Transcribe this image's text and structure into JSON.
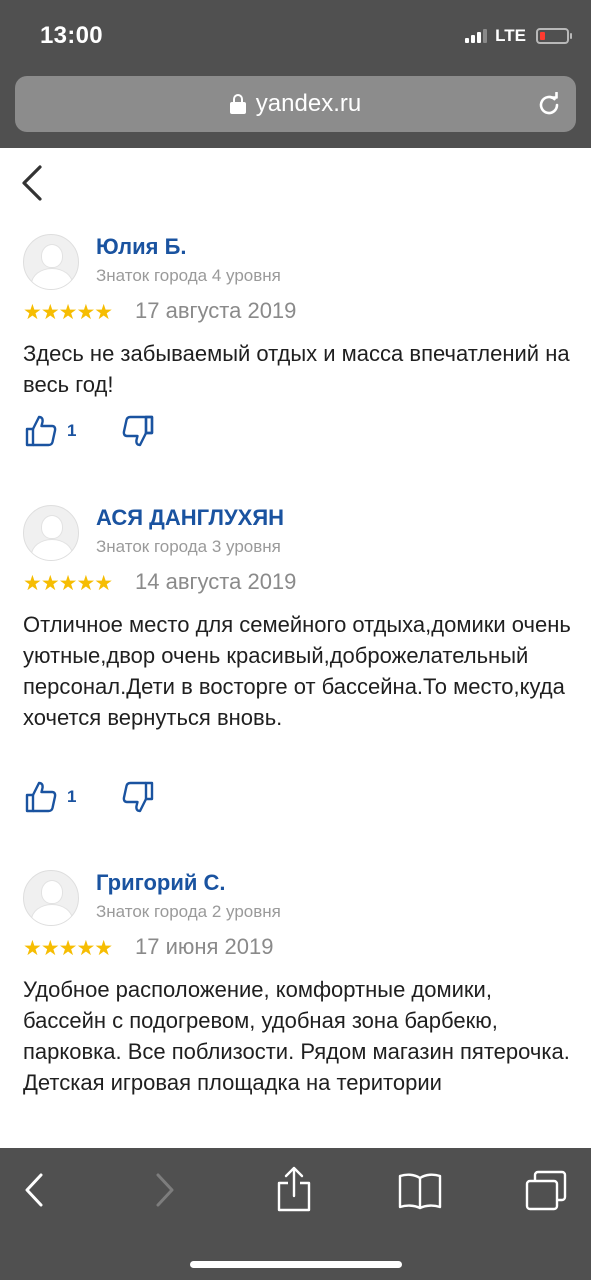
{
  "status_bar": {
    "time": "13:00",
    "network": "LTE"
  },
  "browser": {
    "url": "yandex.ru"
  },
  "reviews": [
    {
      "name": "Юлия Б.",
      "level": "Знаток города 4 уровня",
      "rating": 5,
      "stars": "★★★★★",
      "date": "17 августа 2019",
      "text": "Здесь не забываемый отдых и масса впечатлений на весь год!",
      "likes": "1"
    },
    {
      "name": "АСЯ ДАНГЛУХЯН",
      "level": "Знаток города 3 уровня",
      "rating": 5,
      "stars": "★★★★★",
      "date": "14 августа 2019",
      "text": "Отличное место для семейного отдыха,домики очень уютные,двор очень красивый,доброжелательный персонал.Дети в восторге от бассейна.То место,куда хочется вернуться вновь.",
      "likes": "1"
    },
    {
      "name": "Григорий С.",
      "level": "Знаток города 2 уровня",
      "rating": 5,
      "stars": "★★★★★",
      "date": "17 июня 2019",
      "text": "Удобное расположение, комфортные домики, бассейн с подогревом, удобная зона барбекю, парковка. Все поблизости. Рядом магазин пятерочка. Детская игровая площадка на територии"
    }
  ],
  "colors": {
    "link_blue": "#1a53a0",
    "star_gold": "#f6bd02",
    "chrome_gray": "#505050"
  }
}
